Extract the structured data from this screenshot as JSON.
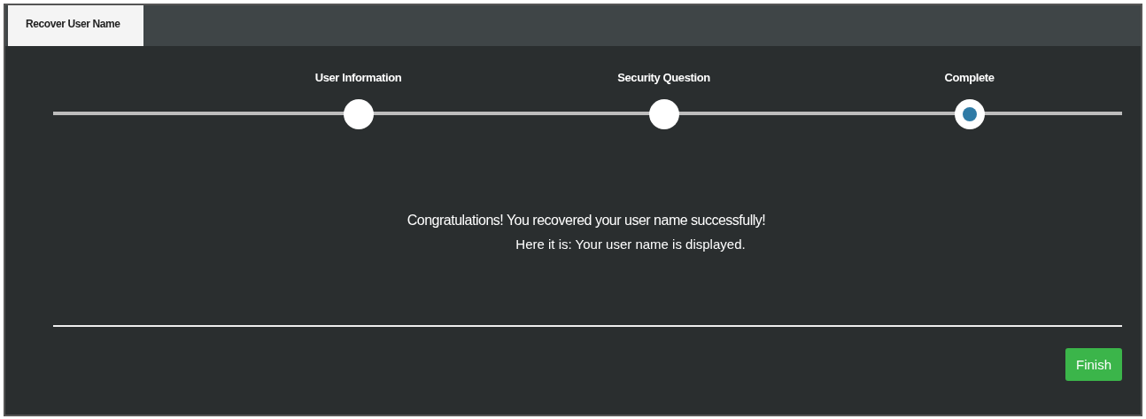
{
  "tabs": [
    {
      "label": "Recover User Name",
      "selected": true
    }
  ],
  "steps": [
    {
      "label": "User Information",
      "selected": false
    },
    {
      "label": "Security Question",
      "selected": false
    },
    {
      "label": "Complete",
      "selected": true
    }
  ],
  "message": {
    "headline": "Congratulations! You recovered your user name successfully!",
    "detail": "Here it is: Your user name is displayed."
  },
  "buttons": [
    {
      "label": "Finish"
    }
  ]
}
